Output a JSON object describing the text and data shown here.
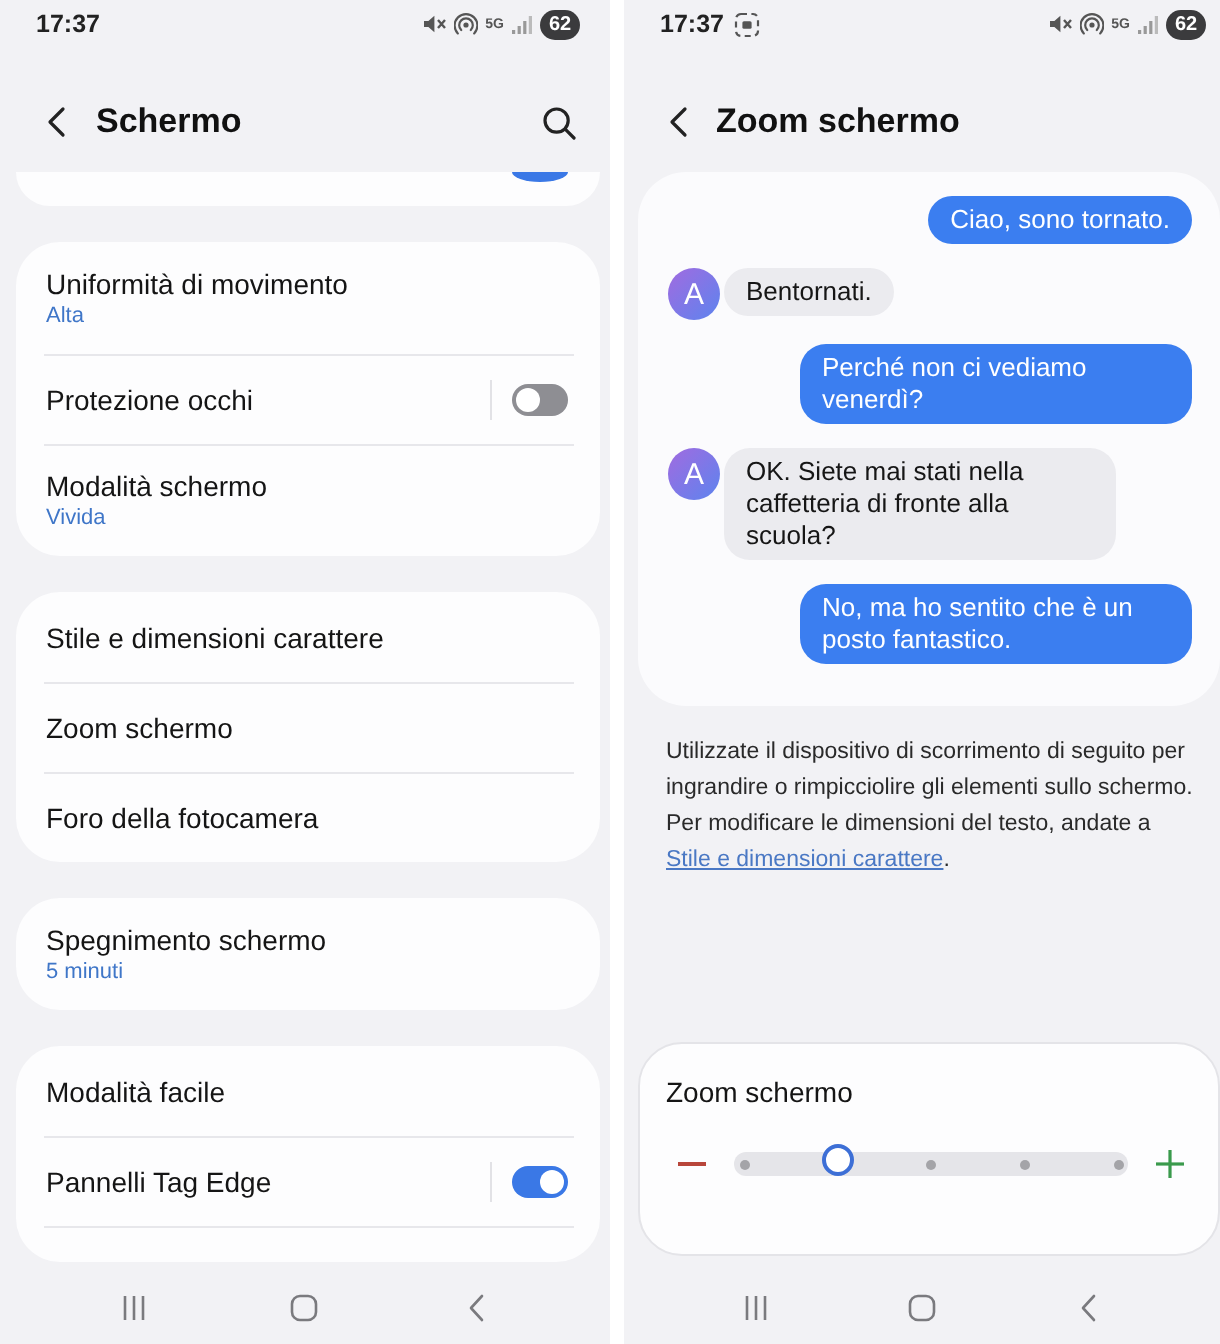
{
  "left_screen": {
    "status_bar": {
      "time": "17:37",
      "network": "5G",
      "battery": "62",
      "capture_icon": false
    },
    "header": {
      "title": "Schermo",
      "search": true
    },
    "groups": [
      {
        "cut_off": true,
        "items": [
          {
            "kind": "toggle",
            "on": true
          }
        ]
      },
      {
        "cut_off": false,
        "items": [
          {
            "kind": "link",
            "title": "Uniformità di movimento",
            "subtitle": "Alta"
          },
          {
            "kind": "toggle",
            "title": "Protezione occhi",
            "on": false
          },
          {
            "kind": "link",
            "title": "Modalità schermo",
            "subtitle": "Vivida"
          }
        ]
      },
      {
        "cut_off": false,
        "items": [
          {
            "kind": "link",
            "title": "Stile e dimensioni carattere"
          },
          {
            "kind": "link",
            "title": "Zoom schermo"
          },
          {
            "kind": "link",
            "title": "Foro della fotocamera"
          }
        ]
      },
      {
        "cut_off": false,
        "items": [
          {
            "kind": "link",
            "title": "Spegnimento schermo",
            "subtitle": "5 minuti"
          }
        ]
      },
      {
        "cut_off": true,
        "items": [
          {
            "kind": "link",
            "title": "Modalità facile"
          },
          {
            "kind": "toggle",
            "title": "Pannelli Tag Edge",
            "on": true
          }
        ]
      }
    ]
  },
  "right_screen": {
    "status_bar": {
      "time": "17:37",
      "network": "5G",
      "battery": "62",
      "capture_icon": true
    },
    "header": {
      "title": "Zoom schermo",
      "search": false
    },
    "preview": {
      "messages": [
        {
          "kind": "sent",
          "text": "Ciao, sono tornato."
        },
        {
          "kind": "received",
          "avatar": "A",
          "text": "Bentornati."
        },
        {
          "kind": "sent",
          "text": "Perché non ci vediamo venerdì?"
        },
        {
          "kind": "received",
          "avatar": "A",
          "text": "OK. Siete mai stati nella caffetteria di fronte alla scuola?"
        },
        {
          "kind": "sent",
          "text": "No, ma ho sentito che è un posto fantastico."
        }
      ]
    },
    "description": {
      "text": "Utilizzate il dispositivo di scorrimento di seguito per ingrandire o rimpicciolire gli elementi sullo schermo. Per modificare le dimensioni del testo, andate a",
      "link": "Stile e dimensioni carattere",
      "end": "."
    },
    "zoom_panel": {
      "title": "Zoom schermo",
      "level": 0.25
    }
  }
}
